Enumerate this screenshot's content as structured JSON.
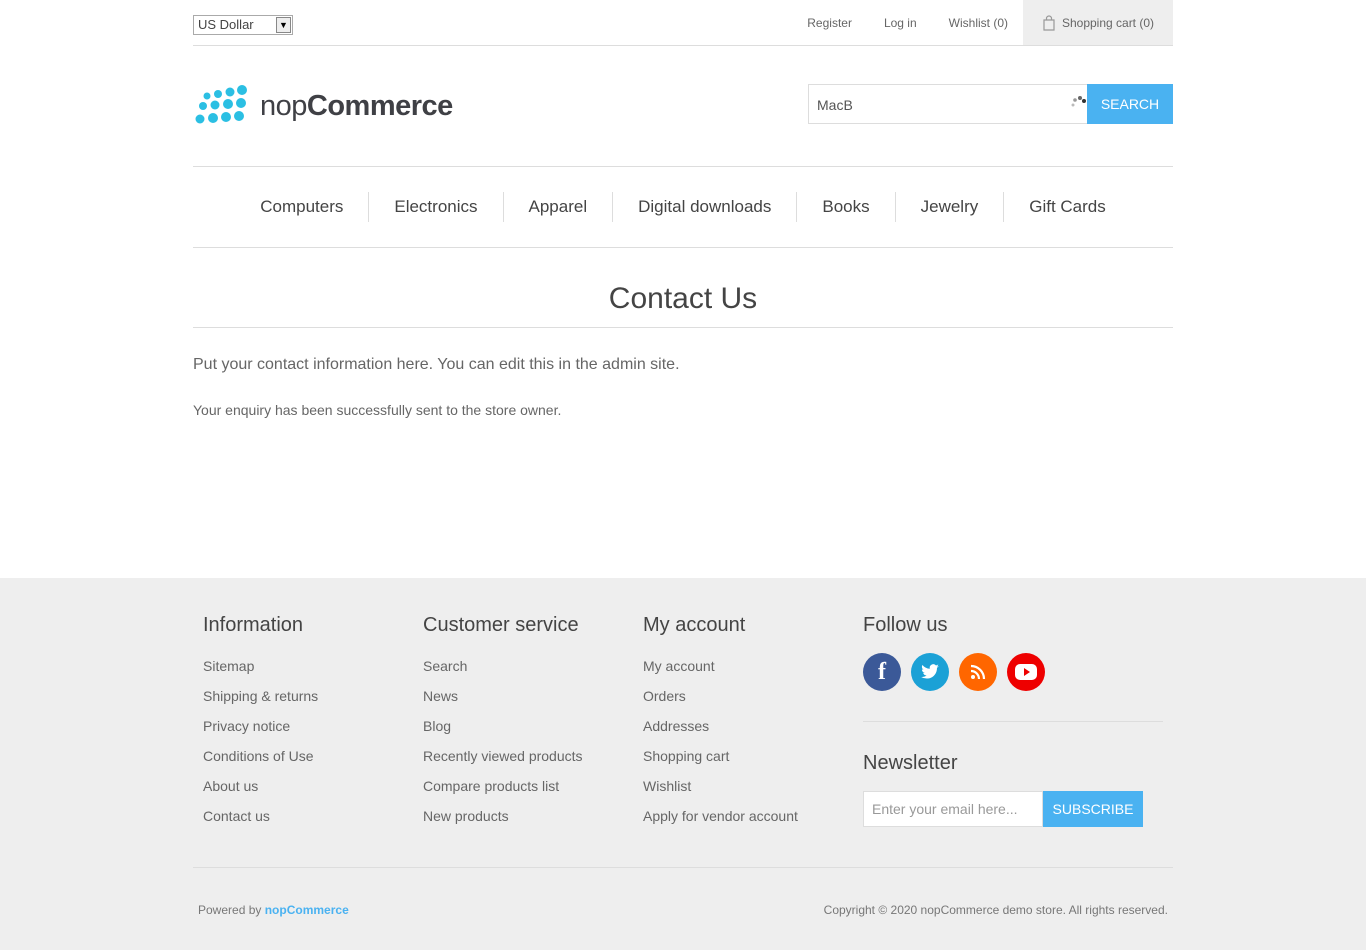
{
  "header": {
    "currency": "US Dollar",
    "links": {
      "register": "Register",
      "login": "Log in",
      "wishlist": "Wishlist (0)",
      "cart": "Shopping cart (0)"
    }
  },
  "logo": {
    "prefix": "nop",
    "suffix": "Commerce"
  },
  "search": {
    "value": "MacB",
    "button": "SEARCH"
  },
  "menu": [
    "Computers",
    "Electronics",
    "Apparel",
    "Digital downloads",
    "Books",
    "Jewelry",
    "Gift Cards"
  ],
  "main": {
    "title": "Contact Us",
    "topic": "Put your contact information here. You can edit this in the admin site.",
    "result": "Your enquiry has been successfully sent to the store owner."
  },
  "footer": {
    "information": {
      "title": "Information",
      "items": [
        "Sitemap",
        "Shipping & returns",
        "Privacy notice",
        "Conditions of Use",
        "About us",
        "Contact us"
      ]
    },
    "customer_service": {
      "title": "Customer service",
      "items": [
        "Search",
        "News",
        "Blog",
        "Recently viewed products",
        "Compare products list",
        "New products"
      ]
    },
    "my_account": {
      "title": "My account",
      "items": [
        "My account",
        "Orders",
        "Addresses",
        "Shopping cart",
        "Wishlist",
        "Apply for vendor account"
      ]
    },
    "follow": {
      "title": "Follow us",
      "icons": [
        "facebook-icon",
        "twitter-icon",
        "rss-icon",
        "youtube-icon"
      ]
    },
    "newsletter": {
      "title": "Newsletter",
      "placeholder": "Enter your email here...",
      "button": "SUBSCRIBE"
    },
    "powered_prefix": "Powered by",
    "powered_link": "nopCommerce",
    "copyright": "Copyright © 2020 nopCommerce demo store. All rights reserved."
  },
  "colors": {
    "accent": "#4ab2f1",
    "footer_bg": "#eeeeee"
  }
}
